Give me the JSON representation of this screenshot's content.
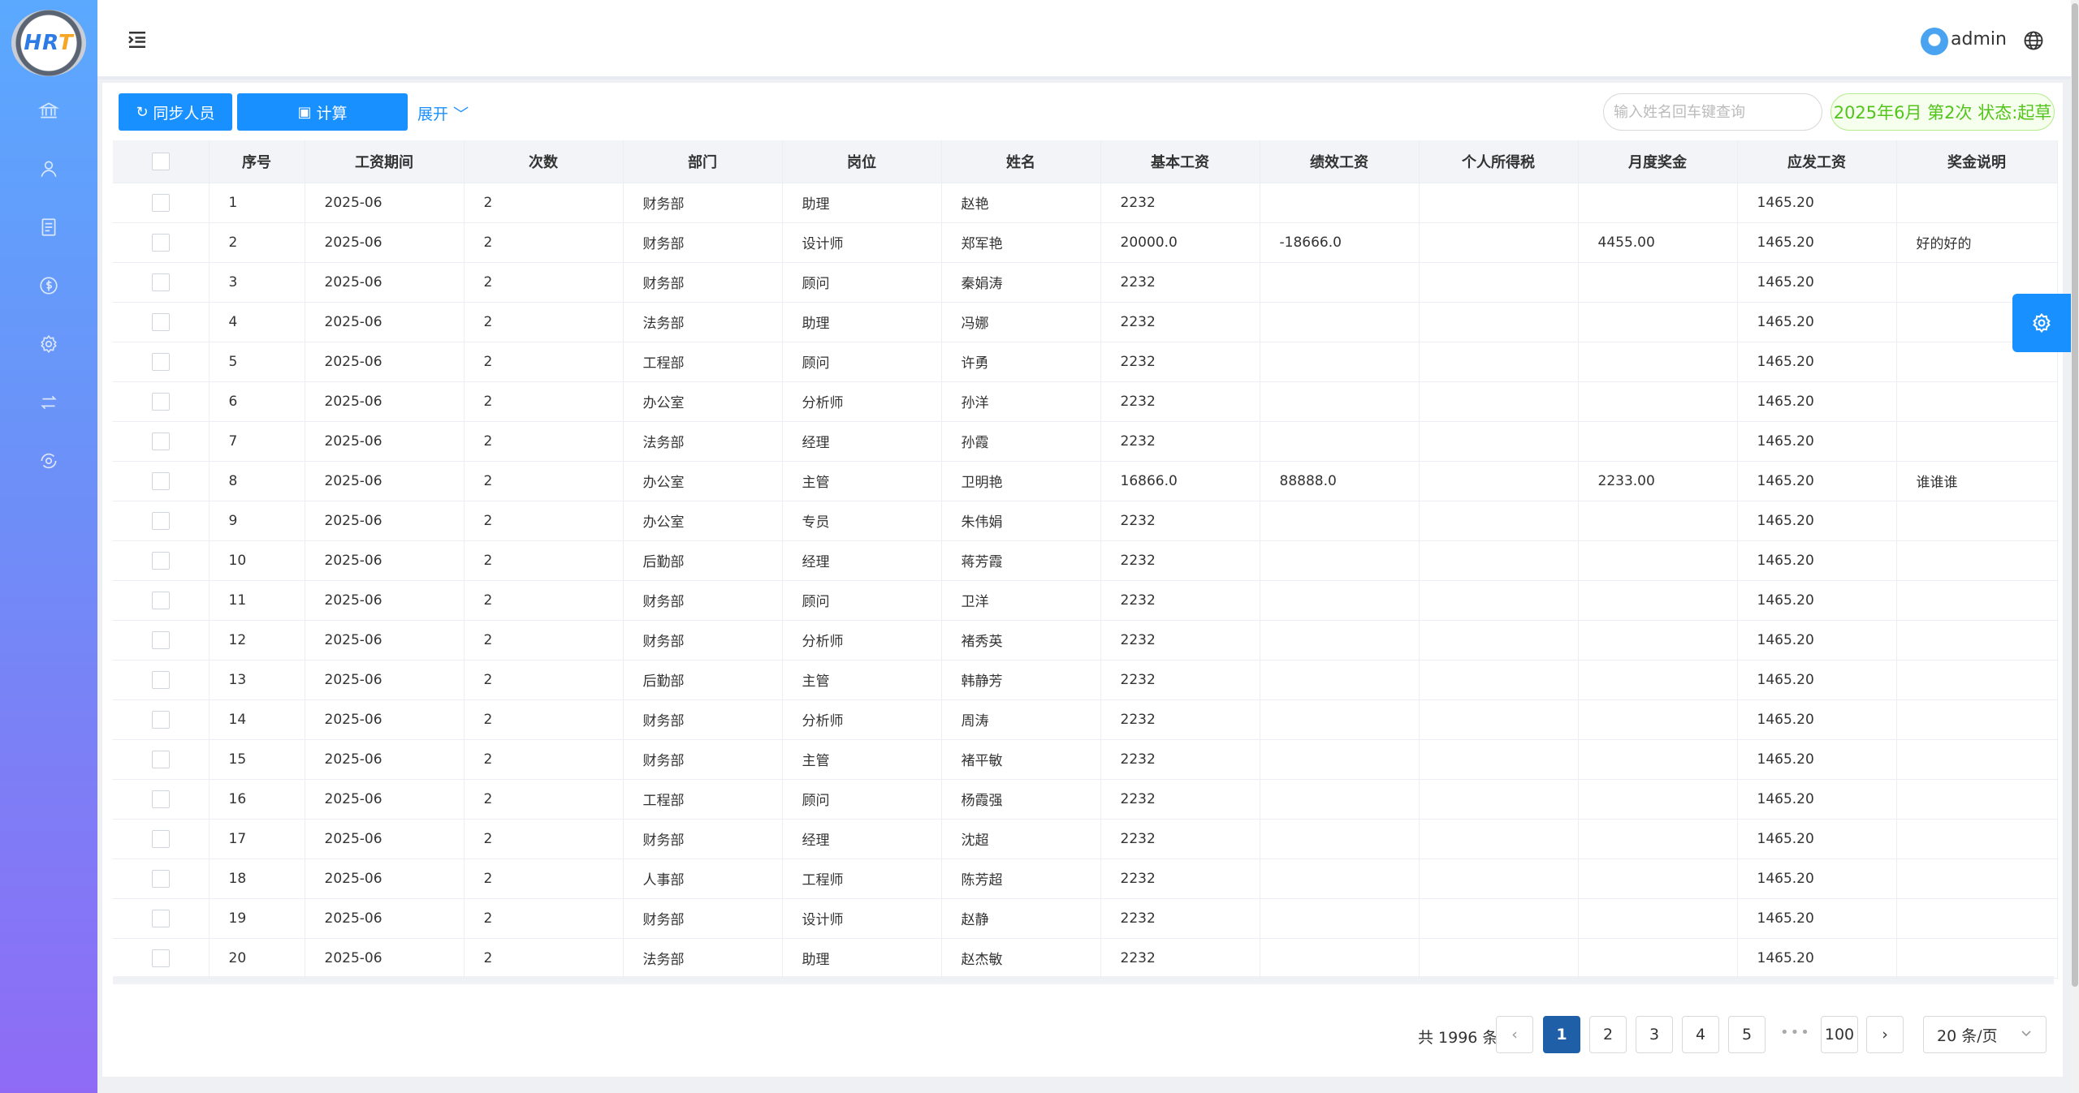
{
  "logo": {
    "text_main": "HR",
    "text_accent": "T"
  },
  "header": {
    "username": "admin"
  },
  "toolbar": {
    "sync_label": "同步人员",
    "calc_label": "计算",
    "expand_label": "展开",
    "search_placeholder": "输入姓名回车键查询",
    "status_text": "2025年6月 第2次 状态:起草"
  },
  "colors": {
    "primary": "#1890ff",
    "status_green": "#52c41a",
    "active_page": "#1f5fa8"
  },
  "table": {
    "columns": [
      "序号",
      "工资期间",
      "次数",
      "部门",
      "岗位",
      "姓名",
      "基本工资",
      "绩效工资",
      "个人所得税",
      "月度奖金",
      "应发工资",
      "奖金说明"
    ],
    "rows": [
      [
        "1",
        "2025-06",
        "2",
        "财务部",
        "助理",
        "赵艳",
        "2232",
        "",
        "",
        "",
        "1465.20",
        ""
      ],
      [
        "2",
        "2025-06",
        "2",
        "财务部",
        "设计师",
        "郑军艳",
        "20000.0",
        "-18666.0",
        "",
        "4455.00",
        "1465.20",
        "好的好的"
      ],
      [
        "3",
        "2025-06",
        "2",
        "财务部",
        "顾问",
        "秦娟涛",
        "2232",
        "",
        "",
        "",
        "1465.20",
        ""
      ],
      [
        "4",
        "2025-06",
        "2",
        "法务部",
        "助理",
        "冯娜",
        "2232",
        "",
        "",
        "",
        "1465.20",
        ""
      ],
      [
        "5",
        "2025-06",
        "2",
        "工程部",
        "顾问",
        "许勇",
        "2232",
        "",
        "",
        "",
        "1465.20",
        ""
      ],
      [
        "6",
        "2025-06",
        "2",
        "办公室",
        "分析师",
        "孙洋",
        "2232",
        "",
        "",
        "",
        "1465.20",
        ""
      ],
      [
        "7",
        "2025-06",
        "2",
        "法务部",
        "经理",
        "孙霞",
        "2232",
        "",
        "",
        "",
        "1465.20",
        ""
      ],
      [
        "8",
        "2025-06",
        "2",
        "办公室",
        "主管",
        "卫明艳",
        "16866.0",
        "88888.0",
        "",
        "2233.00",
        "1465.20",
        "谁谁谁"
      ],
      [
        "9",
        "2025-06",
        "2",
        "办公室",
        "专员",
        "朱伟娟",
        "2232",
        "",
        "",
        "",
        "1465.20",
        ""
      ],
      [
        "10",
        "2025-06",
        "2",
        "后勤部",
        "经理",
        "蒋芳霞",
        "2232",
        "",
        "",
        "",
        "1465.20",
        ""
      ],
      [
        "11",
        "2025-06",
        "2",
        "财务部",
        "顾问",
        "卫洋",
        "2232",
        "",
        "",
        "",
        "1465.20",
        ""
      ],
      [
        "12",
        "2025-06",
        "2",
        "财务部",
        "分析师",
        "褚秀英",
        "2232",
        "",
        "",
        "",
        "1465.20",
        ""
      ],
      [
        "13",
        "2025-06",
        "2",
        "后勤部",
        "主管",
        "韩静芳",
        "2232",
        "",
        "",
        "",
        "1465.20",
        ""
      ],
      [
        "14",
        "2025-06",
        "2",
        "财务部",
        "分析师",
        "周涛",
        "2232",
        "",
        "",
        "",
        "1465.20",
        ""
      ],
      [
        "15",
        "2025-06",
        "2",
        "财务部",
        "主管",
        "褚平敏",
        "2232",
        "",
        "",
        "",
        "1465.20",
        ""
      ],
      [
        "16",
        "2025-06",
        "2",
        "工程部",
        "顾问",
        "杨霞强",
        "2232",
        "",
        "",
        "",
        "1465.20",
        ""
      ],
      [
        "17",
        "2025-06",
        "2",
        "财务部",
        "经理",
        "沈超",
        "2232",
        "",
        "",
        "",
        "1465.20",
        ""
      ],
      [
        "18",
        "2025-06",
        "2",
        "人事部",
        "工程师",
        "陈芳超",
        "2232",
        "",
        "",
        "",
        "1465.20",
        ""
      ],
      [
        "19",
        "2025-06",
        "2",
        "财务部",
        "设计师",
        "赵静",
        "2232",
        "",
        "",
        "",
        "1465.20",
        ""
      ],
      [
        "20",
        "2025-06",
        "2",
        "法务部",
        "助理",
        "赵杰敏",
        "2232",
        "",
        "",
        "",
        "1465.20",
        ""
      ]
    ]
  },
  "pagination": {
    "total_text": "共 1996 条",
    "pages": [
      "1",
      "2",
      "3",
      "4",
      "5"
    ],
    "last_page": "100",
    "ellipsis": "•••",
    "page_size": "20 条/页"
  }
}
